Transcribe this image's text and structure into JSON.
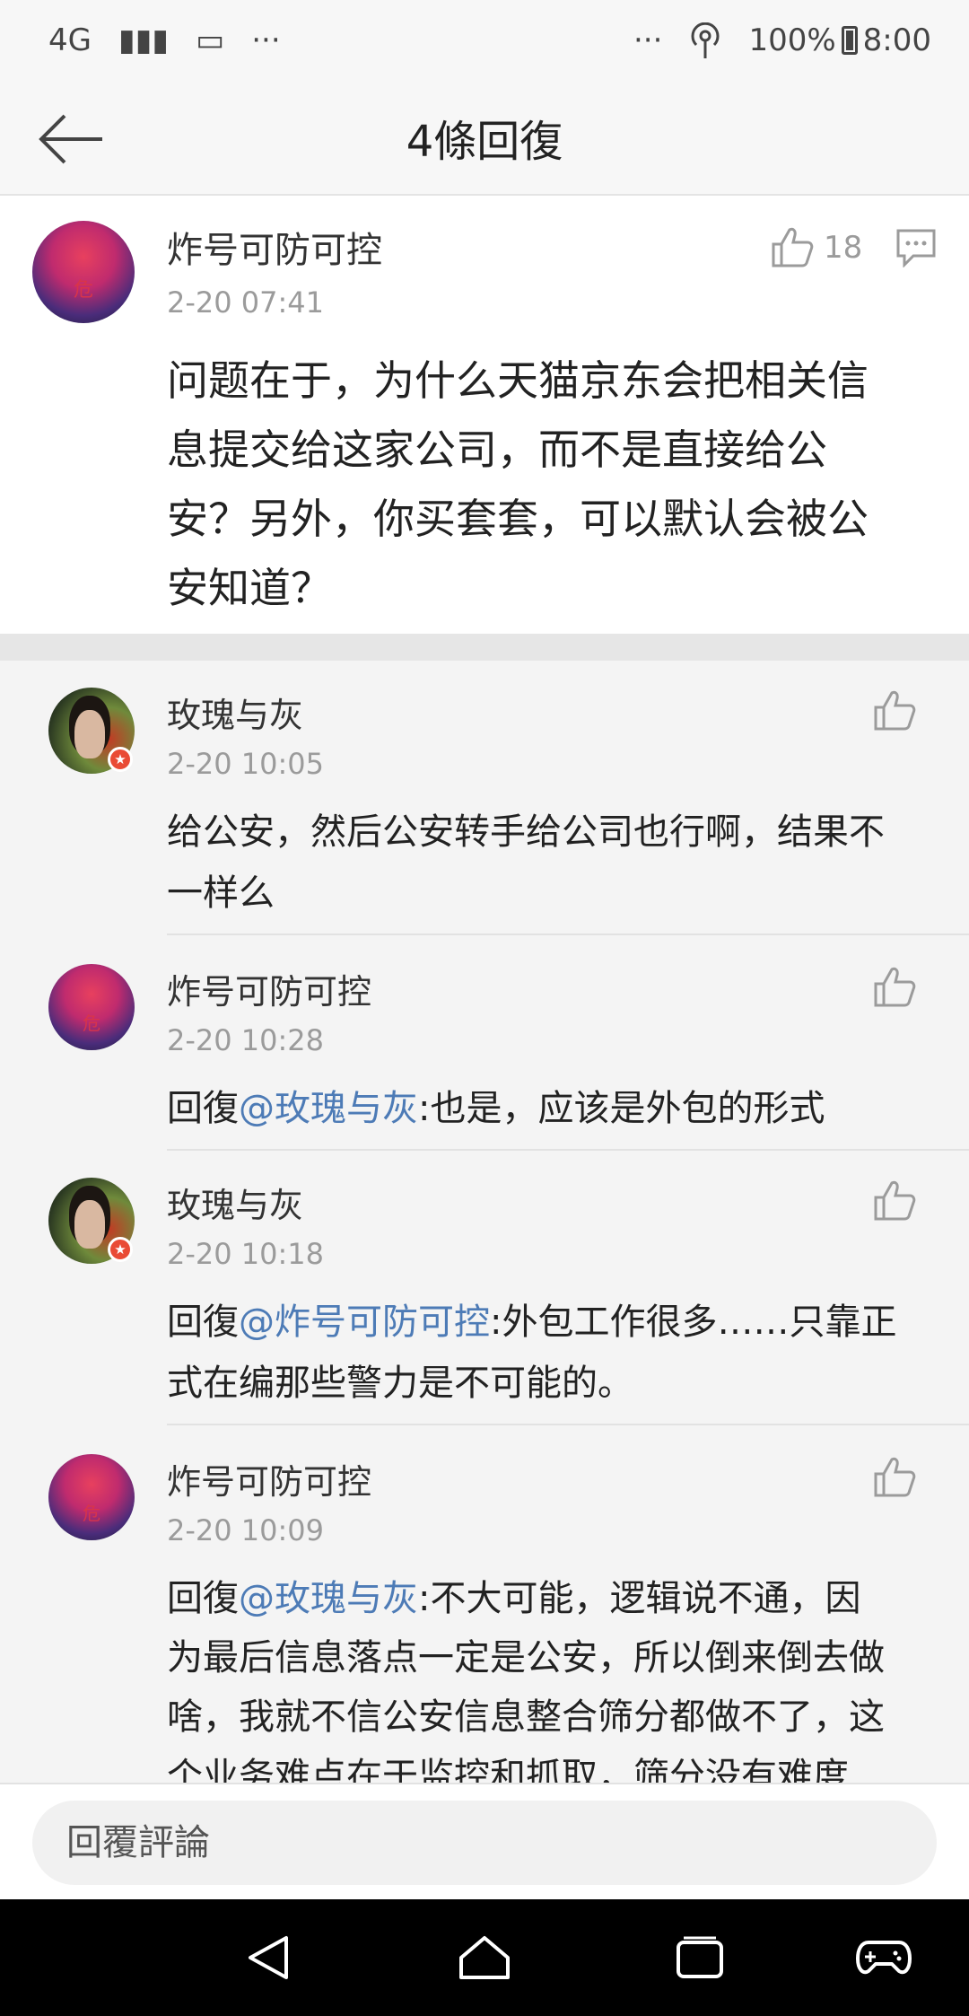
{
  "status_bar": {
    "network": "4G",
    "signal": "▮▮▮",
    "gallery": "▭",
    "more_left": "···",
    "more_right": "···",
    "battery_pct": "100%",
    "time": "8:00"
  },
  "header": {
    "title": "4條回復"
  },
  "main_comment": {
    "author": "炸号可防可控",
    "time": "2-20 07:41",
    "likes": "18",
    "text_lines": [
      "问题在于，为什么天猫京东会把相关信",
      "息提交给这家公司，而不是直接给公",
      "安？另外，你买套套，可以默认会被公",
      "安知道？"
    ],
    "avatar_mark": "危"
  },
  "replies": [
    {
      "author": "玫瑰与灰",
      "time": "2-20 10:05",
      "reply_prefix": "",
      "mention": "",
      "text_lines": [
        "给公安，然后公安转手给公司也行啊，结果不",
        "一样么"
      ]
    },
    {
      "author": "炸号可防可控",
      "time": "2-20 10:28",
      "reply_prefix": "回復",
      "mention": "@玫瑰与灰",
      "text_lines": [
        ":也是，应该是外包的形式"
      ],
      "avatar_mark": "危"
    },
    {
      "author": "玫瑰与灰",
      "time": "2-20 10:18",
      "reply_prefix": "回復",
      "mention": "@炸号可防可控",
      "text_lines": [
        ":外包工作很多……只靠正",
        "式在编那些警力是不可能的。"
      ]
    },
    {
      "author": "炸号可防可控",
      "time": "2-20 10:09",
      "reply_prefix": "回復",
      "mention": "@玫瑰与灰",
      "text_lines": [
        ":不大可能，逻辑说不通，因",
        "为最后信息落点一定是公安，所以倒来倒去做",
        "啥，我就不信公安信息整合筛分都做不了，这",
        "个业务难点在于监控和抓取，筛分没有难度"
      ],
      "avatar_mark": "危"
    }
  ],
  "reply_bar": {
    "placeholder": "回覆評論"
  },
  "badge_mark": "★",
  "colors": {
    "mention": "#4d7bb6",
    "badge": "#e94b35",
    "nav_bg": "#000000"
  }
}
